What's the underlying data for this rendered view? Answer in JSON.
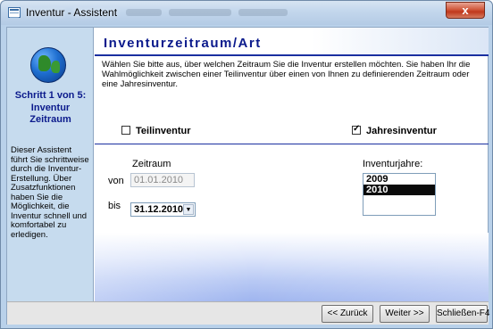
{
  "window": {
    "title": "Inventur - Assistent",
    "close_label": "x"
  },
  "left_panel": {
    "step": "Schritt 1 von 5:",
    "step_title_line1": "Inventur",
    "step_title_line2": "Zeitraum",
    "description": "Dieser Assistent führt Sie schrittweise durch die Inventur-Erstellung. Über Zusatzfunktionen haben Sie die Möglichkeit, die Inventur schnell und komfortabel zu erledigen."
  },
  "header": {
    "title": "Inventurzeitraum/Art",
    "intro": "Wählen Sie bitte aus, über welchen Zeitraum Sie die Inventur erstellen möchten. Sie haben Ihr die Wahlmöglichkeit zwischen einer Teilinventur über einen von Ihnen zu definierenden Zeitraum oder eine Jahresinventur."
  },
  "options": {
    "teilinventur": {
      "label": "Teilinventur",
      "checked": false
    },
    "jahresinventur": {
      "label": "Jahresinventur",
      "checked": true
    }
  },
  "zeitraum": {
    "label": "Zeitraum",
    "von_label": "von",
    "von_value": "01.01.2010",
    "bis_label": "bis",
    "bis_value": "31.12.2010"
  },
  "inventurjahre": {
    "label": "Inventurjahre:",
    "items": [
      "2009",
      "2010"
    ],
    "selected": "2010"
  },
  "buttons": {
    "back": "<< Zurück",
    "next": "Weiter >>",
    "close": "Schließen-F4"
  },
  "colors": {
    "accent": "#0b1a8c",
    "left_panel_bg": "#c6dbee",
    "close_button": "#c0381c"
  }
}
